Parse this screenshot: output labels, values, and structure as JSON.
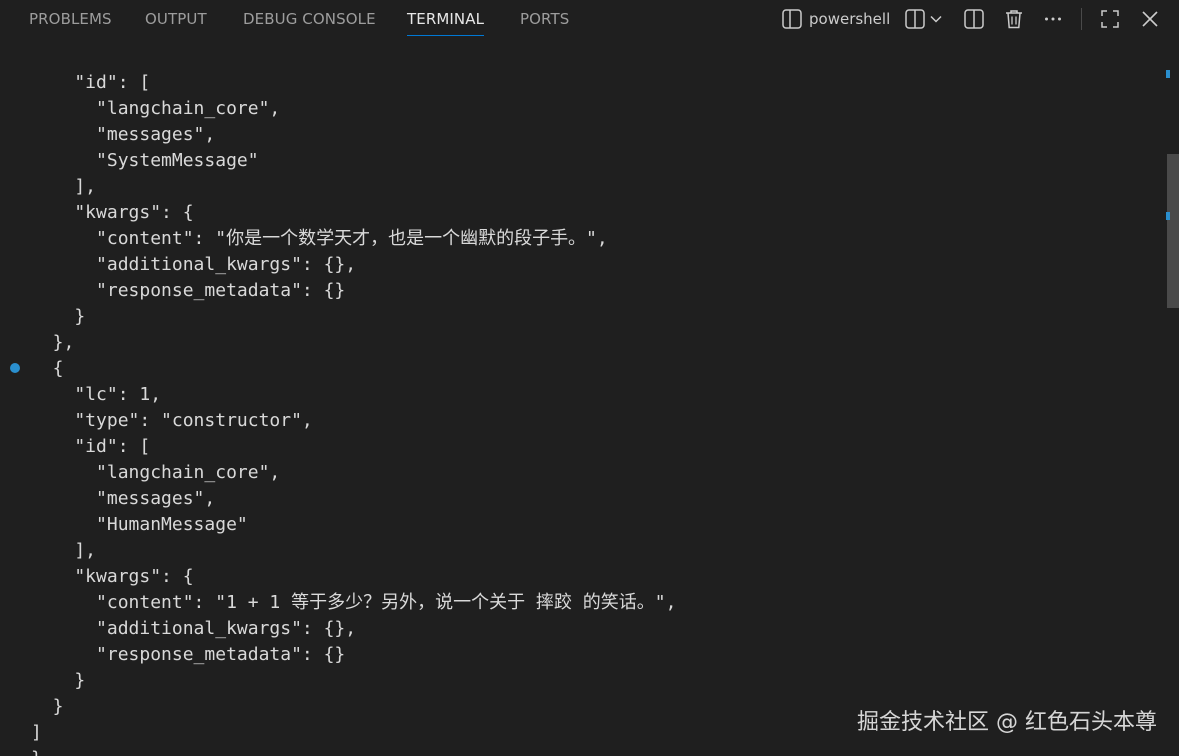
{
  "panel_tabs": [
    {
      "label": "PROBLEMS"
    },
    {
      "label": "OUTPUT"
    },
    {
      "label": "DEBUG CONSOLE"
    },
    {
      "label": "TERMINAL",
      "active": true
    },
    {
      "label": "PORTS"
    }
  ],
  "toolbar": {
    "shell_name": "powershell",
    "icons": [
      "terminal-panel-icon",
      "split-terminal-icon",
      "chevron-down-icon",
      "split-icon",
      "trash-icon",
      "more-icon",
      "maximize-icon",
      "close-icon"
    ]
  },
  "terminal": {
    "lines": [
      "    \"id\": [",
      "      \"langchain_core\",",
      "      \"messages\",",
      "      \"SystemMessage\"",
      "    ],",
      "    \"kwargs\": {",
      "      \"content\": \"你是一个数学天才，也是一个幽默的段子手。\",",
      "      \"additional_kwargs\": {},",
      "      \"response_metadata\": {}",
      "    }",
      "  },",
      "  {",
      "    \"lc\": 1,",
      "    \"type\": \"constructor\",",
      "    \"id\": [",
      "      \"langchain_core\",",
      "      \"messages\",",
      "      \"HumanMessage\"",
      "    ],",
      "    \"kwargs\": {",
      "      \"content\": \"1 + 1 等于多少？另外，说一个关于 摔跤 的笑话。\",",
      "      \"additional_kwargs\": {},",
      "      \"response_metadata\": {}",
      "    }",
      "  }",
      "]",
      "}"
    ]
  },
  "watermark": "掘金技术社区 @ 红色石头本尊",
  "colors": {
    "background": "#1f1f1f",
    "accent": "#0078d4",
    "marker": "#2a8fce",
    "text": "#d9d9d9"
  }
}
